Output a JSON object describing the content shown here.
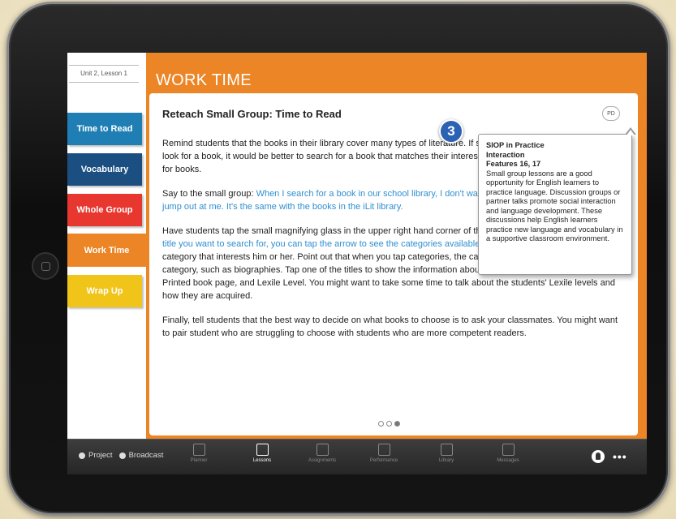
{
  "sidebar": {
    "unit_label": "Unit 2, Lesson 1",
    "items": [
      {
        "label": "Time to Read"
      },
      {
        "label": "Vocabulary"
      },
      {
        "label": "Whole Group"
      },
      {
        "label": "Work Time"
      },
      {
        "label": "Wrap Up"
      }
    ]
  },
  "main": {
    "section_title": "WORK TIME",
    "card_title": "Reteach Small Group: Time to Read",
    "pd_label": "PD",
    "p1": "Remind students that the books in their library cover many types of literature. If students want to spin the carrousel to look for a book, it would be better to search for a book that matches their interests. Review the feature for searching for books.",
    "p2_a": "Say to the small group: ",
    "p2_b": "When I search for a book in our school library, I don't want to spend time looking for a book to jump out at me. It's the same with the books in the iLit library.",
    "p3_a": "Have students tap the small magnifying glass in the upper right hand corner of the screen. Say: ",
    "p3_b": "If you can't think of a title you want to search for, you can tap the arrow to see the categories available.",
    "p3_c": " Have a student volunteer tell a category that interests him or her. Point out that when you tap categories, the carrousel will fill up with books in this category, such as biographies. Tap one of the titles to show the information about the book. Point out the Genre, Printed book page, and Lexile Level. You might want to take some time to talk about the students' Lexile levels and how they are acquired.",
    "p4": "Finally, tell students that the best way to decide on what books to choose is to ask your classmates. You might want to pair student who are struggling to choose with students who are more competent readers."
  },
  "callout": {
    "number": "3",
    "heading1": "SIOP in Practice",
    "heading2": "Interaction",
    "heading3": "Features 16, 17",
    "text": "Small group lessons are a good opportunity for English learners to practice language. Discussion groups or partner talks promote social interaction and language development. These discussions help English learners practice new language and vocabulary in a supportive classroom environment."
  },
  "toolbar": {
    "project": "Project",
    "broadcast": "Broadcast",
    "tabs": [
      {
        "label": "Planner",
        "icon": "planner-icon"
      },
      {
        "label": "Lessons",
        "icon": "lessons-icon"
      },
      {
        "label": "Assignments",
        "icon": "assignments-icon"
      },
      {
        "label": "Performance",
        "icon": "performance-icon"
      },
      {
        "label": "Library",
        "icon": "library-icon"
      },
      {
        "label": "Messages",
        "icon": "messages-icon"
      }
    ],
    "more": "•••"
  },
  "colors": {
    "accent_orange": "#ec8526",
    "time_to_read": "#1f7fb5",
    "vocabulary": "#1b4f82",
    "whole_group": "#e8372f",
    "wrap_up": "#f0c419",
    "link_blue": "#2f8fd0"
  },
  "pagination": {
    "total": 3,
    "current": 3
  }
}
